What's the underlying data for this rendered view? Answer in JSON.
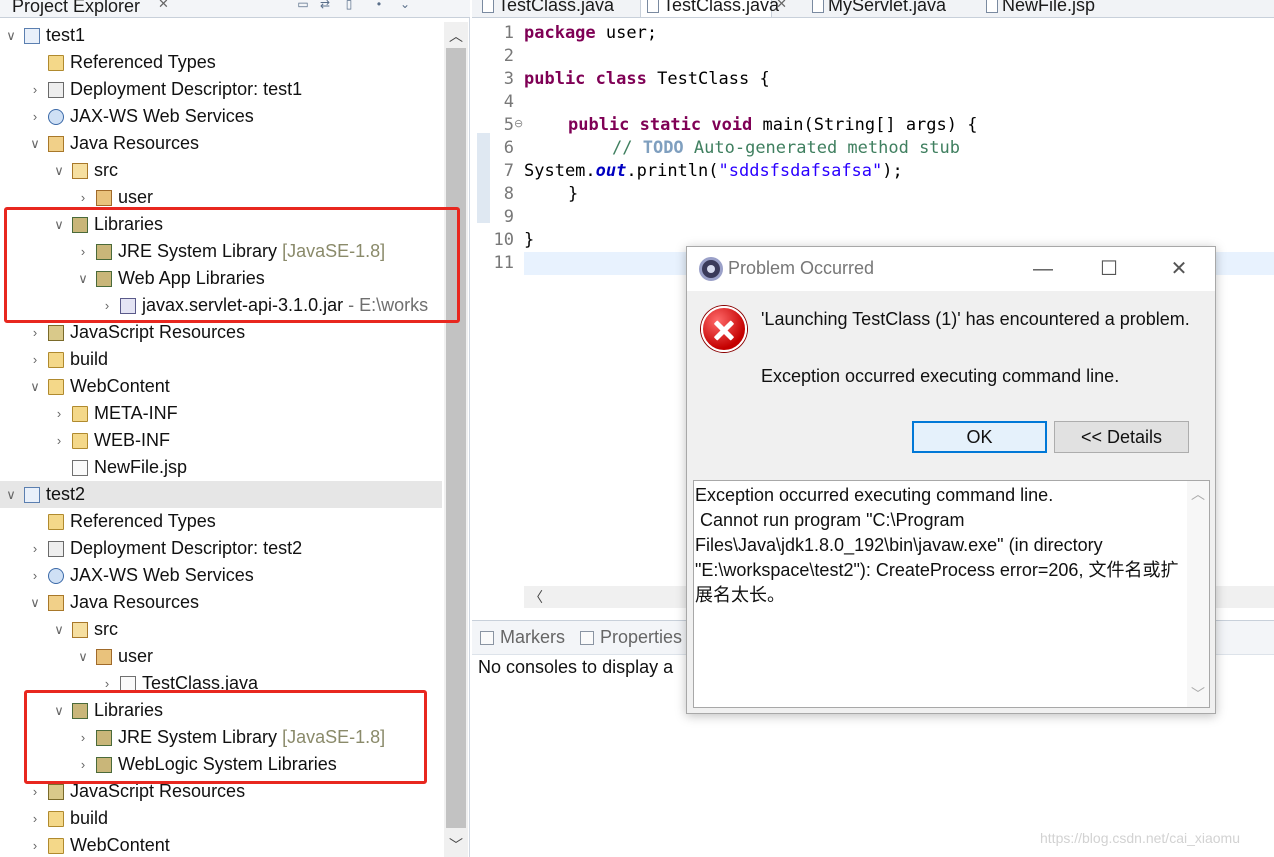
{
  "explorer": {
    "title": "Project Explorer",
    "close": "✕"
  },
  "tree": [
    {
      "label": "test1",
      "indent": 0,
      "twisty": "down",
      "icon": "project-icon",
      "selected": false
    },
    {
      "label": "Referenced Types",
      "indent": 1,
      "twisty": "",
      "icon": "folder-icon"
    },
    {
      "label": "Deployment Descriptor: test1",
      "indent": 1,
      "twisty": "right",
      "icon": "descriptor-icon"
    },
    {
      "label": "JAX-WS Web Services",
      "indent": 1,
      "twisty": "right",
      "icon": "webservice-icon"
    },
    {
      "label": "Java Resources",
      "indent": 1,
      "twisty": "down",
      "icon": "java-resources-icon"
    },
    {
      "label": "src",
      "indent": 2,
      "twisty": "down",
      "icon": "source-folder-icon"
    },
    {
      "label": "user",
      "indent": 3,
      "twisty": "right",
      "icon": "package-icon"
    },
    {
      "label": "Libraries",
      "indent": 2,
      "twisty": "down",
      "icon": "library-icon"
    },
    {
      "label": "JRE System Library",
      "suffix": "[JavaSE-1.8]",
      "indent": 3,
      "twisty": "right",
      "icon": "library-icon"
    },
    {
      "label": "Web App Libraries",
      "indent": 3,
      "twisty": "down",
      "icon": "library-icon"
    },
    {
      "label": "javax.servlet-api-3.1.0.jar",
      "path": " - E:\\works",
      "indent": 4,
      "twisty": "right",
      "icon": "jar-icon"
    },
    {
      "label": "JavaScript Resources",
      "indent": 1,
      "twisty": "right",
      "icon": "js-resources-icon"
    },
    {
      "label": "build",
      "indent": 1,
      "twisty": "right",
      "icon": "folder-icon"
    },
    {
      "label": "WebContent",
      "indent": 1,
      "twisty": "down",
      "icon": "folder-icon"
    },
    {
      "label": "META-INF",
      "indent": 2,
      "twisty": "right",
      "icon": "folder-icon"
    },
    {
      "label": "WEB-INF",
      "indent": 2,
      "twisty": "right",
      "icon": "folder-icon"
    },
    {
      "label": "NewFile.jsp",
      "indent": 2,
      "twisty": "",
      "icon": "jsp-file-icon"
    },
    {
      "label": "test2",
      "indent": 0,
      "twisty": "down",
      "icon": "project-icon",
      "selected": true
    },
    {
      "label": "Referenced Types",
      "indent": 1,
      "twisty": "",
      "icon": "folder-icon"
    },
    {
      "label": "Deployment Descriptor: test2",
      "indent": 1,
      "twisty": "right",
      "icon": "descriptor-icon"
    },
    {
      "label": "JAX-WS Web Services",
      "indent": 1,
      "twisty": "right",
      "icon": "webservice-icon"
    },
    {
      "label": "Java Resources",
      "indent": 1,
      "twisty": "down",
      "icon": "java-resources-icon"
    },
    {
      "label": "src",
      "indent": 2,
      "twisty": "down",
      "icon": "source-folder-icon"
    },
    {
      "label": "user",
      "indent": 3,
      "twisty": "down",
      "icon": "package-icon"
    },
    {
      "label": "TestClass.java",
      "indent": 4,
      "twisty": "right",
      "icon": "java-file-icon"
    },
    {
      "label": "Libraries",
      "indent": 2,
      "twisty": "down",
      "icon": "library-icon"
    },
    {
      "label": "JRE System Library",
      "suffix": "[JavaSE-1.8]",
      "indent": 3,
      "twisty": "right",
      "icon": "library-icon"
    },
    {
      "label": "WebLogic System Libraries",
      "indent": 3,
      "twisty": "right",
      "icon": "library-icon"
    },
    {
      "label": "JavaScript Resources",
      "indent": 1,
      "twisty": "right",
      "icon": "js-resources-icon"
    },
    {
      "label": "build",
      "indent": 1,
      "twisty": "right",
      "icon": "folder-icon"
    },
    {
      "label": "WebContent",
      "indent": 1,
      "twisty": "right",
      "icon": "folder-icon"
    }
  ],
  "editor": {
    "tabs": [
      {
        "label": "TestClass.java",
        "active": false
      },
      {
        "label": "TestClass.java",
        "active": true,
        "close": "✕"
      },
      {
        "label": "MyServlet.java",
        "active": false
      },
      {
        "label": "NewFile.jsp",
        "active": false
      }
    ],
    "line_numbers": [
      "1",
      "2",
      "3",
      "4",
      "5",
      "6",
      "7",
      "8",
      "9",
      "10",
      "11"
    ],
    "fold_marker": "⊖",
    "code": {
      "l1_kw": "package",
      "l1_rest": " user;",
      "l3_kw1": "public",
      "l3_kw2": "class",
      "l3_rest": " TestClass {",
      "l5_kw1": "public",
      "l5_kw2": "static",
      "l5_kw3": "void",
      "l5_rest": " main(String[] args) {",
      "l6_cm1": "// ",
      "l6_todo": "TODO",
      "l6_cm2": " Auto-generated method stub",
      "l7_a": "System.",
      "l7_out": "out",
      "l7_b": ".println(",
      "l7_str": "\"sddsfsdafsafsa\"",
      "l7_c": ");",
      "l8": "}",
      "l10": "}"
    }
  },
  "bottom": {
    "tabs": [
      "Markers",
      "Properties"
    ],
    "empty_text": "No consoles to display a"
  },
  "dialog": {
    "title": "Problem Occurred",
    "minimize": "—",
    "maximize": "☐",
    "close": "✕",
    "message": "'Launching TestClass (1)' has encountered a problem.",
    "reason": "Exception occurred executing command line.",
    "ok_label": "OK",
    "details_label": "<< Details",
    "details_text": "Exception occurred executing command line.\n Cannot run program \"C:\\Program Files\\Java\\jdk1.8.0_192\\bin\\javaw.exe\" (in directory \"E:\\workspace\\test2\"): CreateProcess error=206, 文件名或扩展名太长。"
  },
  "watermark": "https://blog.csdn.net/cai_xiaomu",
  "colors": {
    "highlight_box": "#e8271f",
    "keyword": "#7f0055",
    "comment": "#3f7f5f",
    "string": "#2a00ff",
    "ok_focus": "#0078d7"
  }
}
